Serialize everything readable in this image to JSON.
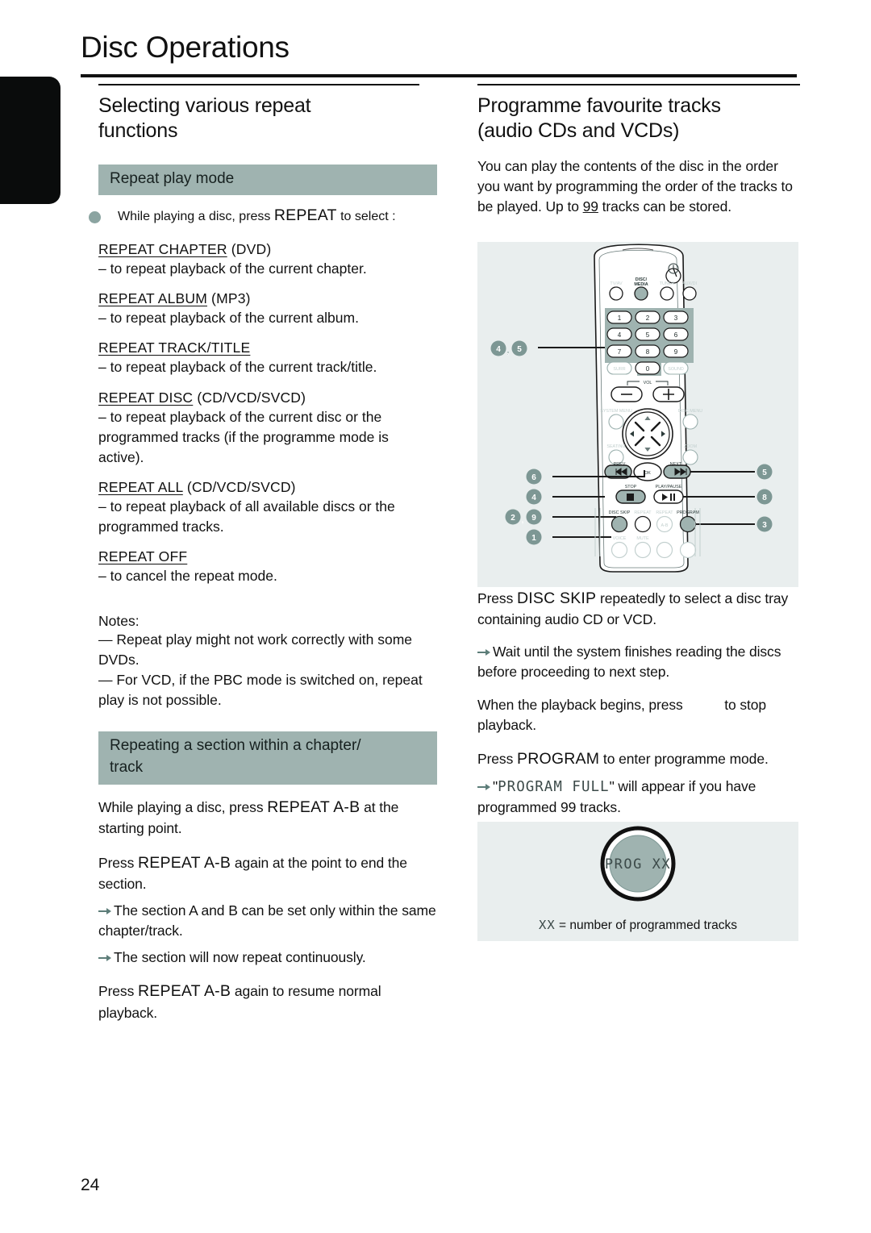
{
  "page": {
    "title": "Disc Operations",
    "number": "24"
  },
  "left": {
    "heading_line1": "Selecting various repeat",
    "heading_line2": "functions",
    "band_repeat_mode": "Repeat play mode",
    "intro_bullet": {
      "pre": "While playing a disc, press ",
      "key": "REPEAT",
      "post": " to select :"
    },
    "modes": [
      {
        "label": "REPEAT CHAPTER",
        "suffix": " (DVD)",
        "desc": "–   to repeat playback of the current chapter."
      },
      {
        "label": "REPEAT ALBUM",
        "suffix": " (MP3)",
        "desc": "–   to repeat playback of the current album."
      },
      {
        "label": "REPEAT TRACK/TITLE",
        "suffix": "",
        "desc": "–   to repeat playback of the current track/title."
      },
      {
        "label": "REPEAT DISC",
        "suffix": " (CD/VCD/SVCD)",
        "desc": "–   to repeat playback of the current disc or the programmed tracks (if the programme mode is active)."
      },
      {
        "label": "REPEAT ALL",
        "suffix": " (CD/VCD/SVCD)",
        "desc": "–   to repeat playback of all available discs or the programmed tracks."
      },
      {
        "label": "REPEAT OFF",
        "suffix": "",
        "desc": "–   to cancel the repeat mode."
      }
    ],
    "notes_title": "Notes:",
    "notes": [
      "—   Repeat play might not work correctly with some DVDs.",
      "—   For VCD, if the PBC mode is switched on, repeat play is not possible."
    ],
    "band_ab_line1": "Repeating a section within a chapter/",
    "band_ab_line2": "track",
    "ab_steps": [
      {
        "pre": "While playing a disc, press ",
        "key": "REPEAT A-B",
        "post": " at the starting point."
      },
      {
        "pre": "Press ",
        "key": "REPEAT A-B",
        "post": " again at the point to end the section."
      }
    ],
    "ab_arrows": [
      "The section A and B can be set only within the same chapter/track.",
      "The section will now repeat continuously."
    ],
    "ab_final": {
      "pre": "Press ",
      "key": "REPEAT A-B",
      "post": " again to resume normal playback."
    }
  },
  "right": {
    "heading_line1": "Programme favourite tracks",
    "heading_line2": "(audio CDs and VCDs)",
    "intro": {
      "p1": "You can play the contents of the disc in the order you want by programming the order of the tracks to be played. Up to ",
      "count": "99",
      "p2": " tracks can be stored."
    },
    "steps": [
      {
        "pre": "Press ",
        "key": "DISC SKIP",
        "post": " repeatedly to select a disc tray containing audio CD or VCD."
      }
    ],
    "arrow_note_1": "Wait until the system finishes reading the discs before proceeding to next step.",
    "step_stop": {
      "pre": "When the playback begins, press ",
      "key": "",
      "post": " to stop playback."
    },
    "step_program": {
      "pre": "Press ",
      "key": "PROGRAM",
      "post": " to enter programme mode."
    },
    "arrow_note_2": {
      "pre": "\"",
      "lcd": "PROGRAM FULL",
      "post": "\" will appear if you have programmed 99 tracks."
    }
  },
  "remote": {
    "source_buttons": [
      "TV/AV",
      "DISC/MEDIA",
      "TUNER",
      "AUX/DI"
    ],
    "keypad": [
      "1",
      "2",
      "3",
      "4",
      "5",
      "6",
      "7",
      "8",
      "9",
      "0"
    ],
    "surr_label": "SURR",
    "sound_label": "SOUND",
    "vol_label": "VOL",
    "vol_minus": "–",
    "vol_plus": "+",
    "system_menu": "SYSTEM MENU",
    "disc_menu": "DISC MENU",
    "seating": "SEATING",
    "zoom": "ZOOM",
    "prev": "PREV",
    "next": "NEXT",
    "ok": "OK",
    "stop": "STOP",
    "play_pause": "PLAY/PAUSE",
    "disc_skip": "DISC SKIP",
    "repeat": "REPEAT",
    "repeat_ab": "REPEAT",
    "repeat_ab_sub": "A-B",
    "program": "PROGRAM",
    "voice": "VOICE",
    "mute": "MUTE",
    "callouts_left": [
      "4, 5",
      "6",
      "4",
      "2, 9",
      "1"
    ],
    "callouts_right": [
      "5",
      "8",
      "3"
    ],
    "colors": {
      "highlight": "#9fb3b0",
      "panel_bg": "#e9eeee",
      "badge": "#7d9794",
      "dim_label": "#c3d0cf"
    }
  },
  "prog_display": {
    "text": "PROG XX",
    "caption_key": "XX",
    "caption_rest": "  = number of programmed tracks"
  }
}
